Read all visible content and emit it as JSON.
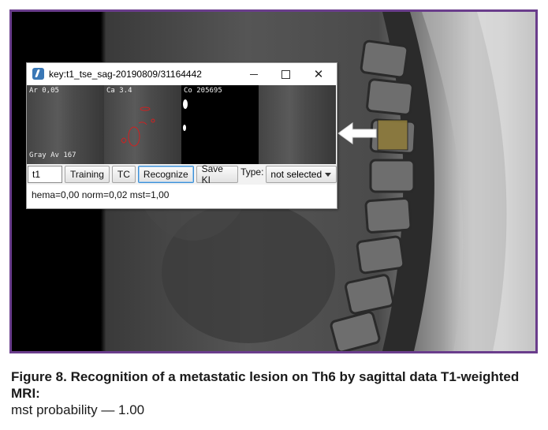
{
  "window": {
    "title": "key:t1_tse_sag-20190809/31164442",
    "minimize_icon": "minimize-icon",
    "maximize_icon": "maximize-icon",
    "close_glyph": "✕"
  },
  "panels": [
    {
      "label": "Ar 0,05",
      "sub": "Gray Av 167"
    },
    {
      "label": "Ca 3.4"
    },
    {
      "label": "Co 205695"
    },
    {
      "label": ""
    }
  ],
  "toolbar": {
    "text_value": "t1",
    "training": "Training",
    "tc": "TC",
    "recognize": "Recognize",
    "save": "Save KI",
    "type_label": "Type:",
    "type_selected": "not selected"
  },
  "status_text": "hema=0,00 norm=0,02 mst=1,00",
  "caption": {
    "title": "Figure 8. Recognition of a metastatic lesion on Th6 by sagittal data T1-weighted MRI:",
    "line2": "mst probability — 1.00"
  },
  "colors": {
    "frame": "#6a3d8c",
    "roi": "#8c7a3a",
    "contour": "#d22020",
    "focus": "#3b8fd6"
  }
}
